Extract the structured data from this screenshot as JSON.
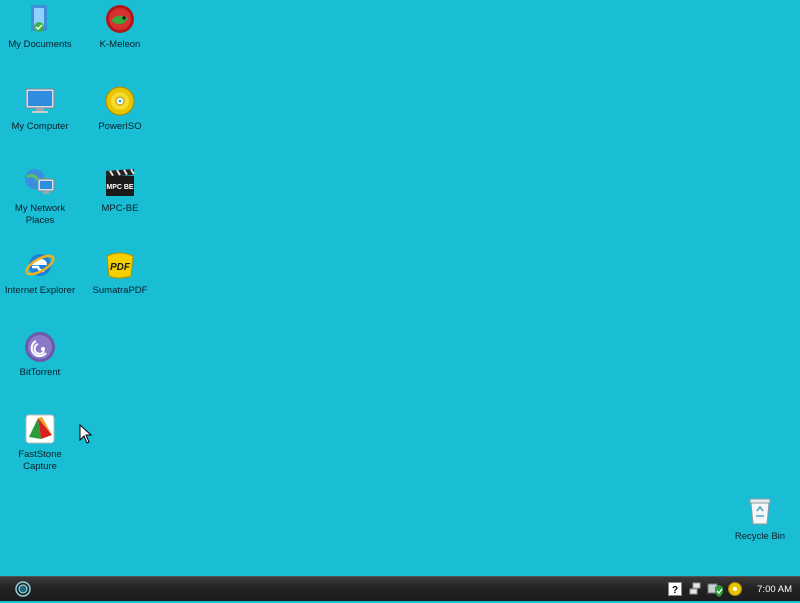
{
  "desktop": {
    "background_color": "#19bed4",
    "icons": [
      {
        "label": "My Documents",
        "icon": "my-documents-icon"
      },
      {
        "label": "K-Meleon",
        "icon": "k-meleon-icon"
      },
      {
        "label": "My Computer",
        "icon": "my-computer-icon"
      },
      {
        "label": "PowerISO",
        "icon": "poweriso-icon"
      },
      {
        "label": "My Network Places",
        "icon": "network-places-icon"
      },
      {
        "label": "MPC-BE",
        "icon": "mpc-be-icon"
      },
      {
        "label": "Internet Explorer",
        "icon": "internet-explorer-icon"
      },
      {
        "label": "SumatraPDF",
        "icon": "sumatrapdf-icon"
      },
      {
        "label": "BitTorrent",
        "icon": "bittorrent-icon"
      },
      {
        "label": "FastStone Capture",
        "icon": "faststone-capture-icon"
      },
      {
        "label": "Recycle Bin",
        "icon": "recycle-bin-icon"
      }
    ]
  },
  "taskbar": {
    "clock": "7:00 AM",
    "mpc_text": "MPC BE",
    "pdf_text": "PDF"
  }
}
